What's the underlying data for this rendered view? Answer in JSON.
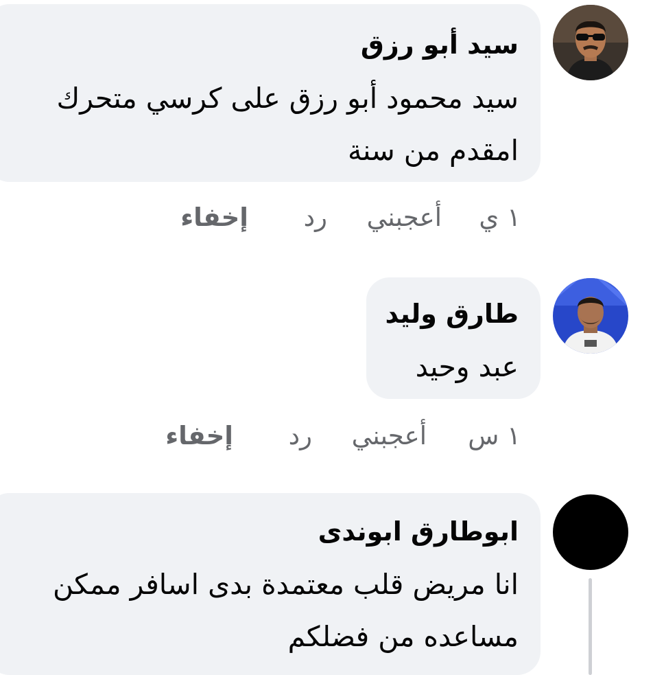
{
  "comments": [
    {
      "author": "سيد أبو رزق",
      "lines": [
        "سيد محمود أبو رزق على كرسي متحرك",
        "امقدم من سنة"
      ],
      "time": "١ ي",
      "like_label": "أعجبني",
      "reply_label": "رد",
      "hide_label": "إخفاء",
      "avatar_icon": "person-sunglasses-avatar"
    },
    {
      "author": "طارق وليد",
      "lines": [
        "عبد وحيد"
      ],
      "time": "١ س",
      "like_label": "أعجبني",
      "reply_label": "رد",
      "hide_label": "إخفاء",
      "avatar_icon": "person-avatar"
    },
    {
      "author": "ابوطارق ابوندى",
      "lines": [
        "انا مريض قلب معتمدة بدى اسافر ممكن",
        "مساعده من فضلكم"
      ],
      "avatar_icon": "black-circle-avatar"
    }
  ],
  "colors": {
    "bubble": "#f0f2f5",
    "text": "#050505",
    "secondary": "#65676b",
    "thread_line": "#ced0d4"
  }
}
